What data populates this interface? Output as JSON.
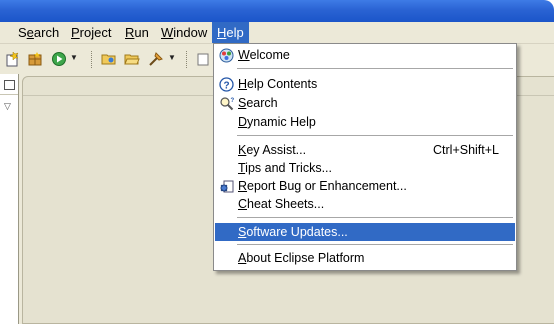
{
  "menubar": {
    "items": [
      {
        "label": "Search",
        "mnemonic_index": 1
      },
      {
        "label": "Project",
        "mnemonic_index": 0
      },
      {
        "label": "Run",
        "mnemonic_index": 0
      },
      {
        "label": "Window",
        "mnemonic_index": 0
      },
      {
        "label": "Help",
        "mnemonic_index": 0,
        "active": true
      }
    ]
  },
  "toolbar": {
    "icons": [
      "new-wizard-icon",
      "new-package-icon",
      "run-icon",
      "open-type-icon",
      "open-resource-icon",
      "debug-launch-icon"
    ]
  },
  "help_menu": {
    "items": [
      {
        "label": "Welcome",
        "icon": "welcome-icon"
      },
      {
        "label": "Help Contents",
        "icon": "help-icon"
      },
      {
        "label": "Search",
        "icon": "search-icon"
      },
      {
        "label": "Dynamic Help"
      },
      {
        "label": "Key Assist...",
        "accelerator": "Ctrl+Shift+L"
      },
      {
        "label": "Tips and Tricks..."
      },
      {
        "label": "Report Bug or Enhancement...",
        "icon": "bug-report-icon"
      },
      {
        "label": "Cheat Sheets..."
      },
      {
        "label": "Software Updates...",
        "highlighted": true
      },
      {
        "label": "About Eclipse Platform"
      }
    ]
  },
  "colors": {
    "selection": "#316ac5",
    "menubar_bg": "#ece9d8",
    "titlebar": "#2a63d3"
  }
}
